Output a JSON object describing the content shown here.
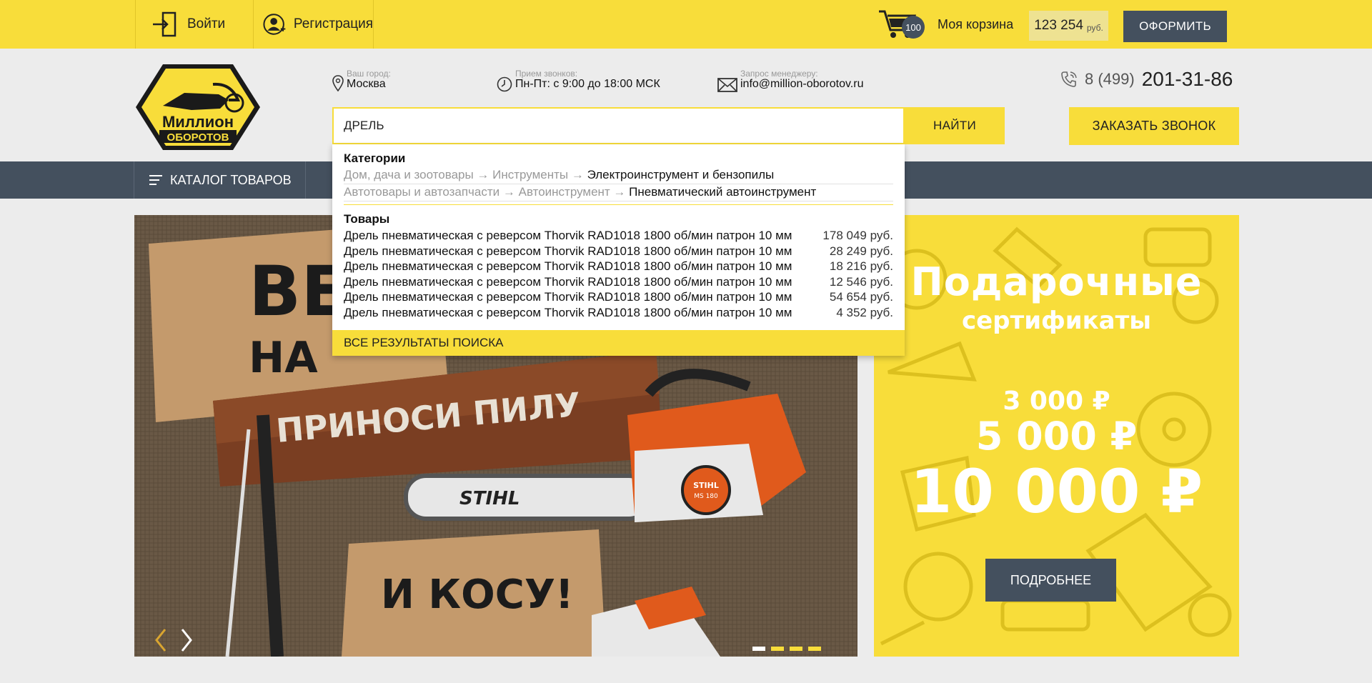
{
  "topbar": {
    "login_label": "Войти",
    "register_label": "Регистрация",
    "cart_count": "100",
    "cart_label": "Моя корзина",
    "cart_total": "123 254",
    "cart_currency": "руб.",
    "checkout_label": "ОФОРМИТЬ"
  },
  "header": {
    "city_label": "Ваш город:",
    "city_value": "Москва",
    "hours_label": "Прием звонков:",
    "hours_value": "Пн-Пт: с 9:00 до 18:00 МСК",
    "email_label": "Запрос менеджеру:",
    "email_value": "info@million-oborotov.ru",
    "phone_code": "8 (499)",
    "phone_number": "201-31-86",
    "logo_line1": "Миллион",
    "logo_line2": "ОБОРОТОВ"
  },
  "search": {
    "query": "ДРЕЛЬ",
    "button_label": "НАЙТИ"
  },
  "callback_label": "ЗАКАЗАТЬ ЗВОНОК",
  "nav": {
    "catalog_label": "КАТАЛОГ ТОВАРОВ"
  },
  "dropdown": {
    "categories_heading": "Категории",
    "categories": [
      {
        "path": "Дом, дача и зоотовары → Инструменты → ",
        "last": "Электроинструмент и бензопилы"
      },
      {
        "path": "Автотовары и автозапчасти → Автоинструмент → ",
        "last": "Пневматический автоинструмент"
      }
    ],
    "products_heading": "Товары",
    "products": [
      {
        "name": "Дрель пневматическая с реверсом Thorvik RAD1018 1800 об/мин патрон 10 мм",
        "price": "178 049 руб."
      },
      {
        "name": "Дрель пневматическая с реверсом Thorvik RAD1018 1800 об/мин патрон 10 мм",
        "price": "28 249 руб."
      },
      {
        "name": "Дрель пневматическая с реверсом Thorvik RAD1018 1800 об/мин патрон 10 мм",
        "price": "18 216 руб."
      },
      {
        "name": "Дрель пневматическая с реверсом Thorvik RAD1018 1800 об/мин патрон 10 мм",
        "price": "12 546 руб."
      },
      {
        "name": "Дрель пневматическая с реверсом Thorvik RAD1018 1800 об/мин патрон 10 мм",
        "price": "54 654 руб."
      },
      {
        "name": "Дрель пневматическая с реверсом Thorvik RAD1018 1800 об/мин патрон 10 мм",
        "price": "4 352 руб."
      }
    ],
    "all_results_label": "ВСЕ РЕЗУЛЬТАТЫ ПОИСКА"
  },
  "banner": {
    "text_top": "ВЕ",
    "text_mid": "НА",
    "text_saw": "ПРИНОСИ ПИЛУ",
    "text_scythe": "И КОСУ!",
    "brand": "STIHL",
    "model": "MS 180"
  },
  "gift": {
    "title": "Подарочные",
    "subtitle": "сертификаты",
    "amount1": "3 000 ₽",
    "amount2": "5 000 ₽",
    "amount3": "10 000 ₽",
    "button_label": "ПОДРОБНЕЕ"
  },
  "colors": {
    "brand_yellow": "#f8dd3a",
    "dark_slate": "#44505e"
  }
}
